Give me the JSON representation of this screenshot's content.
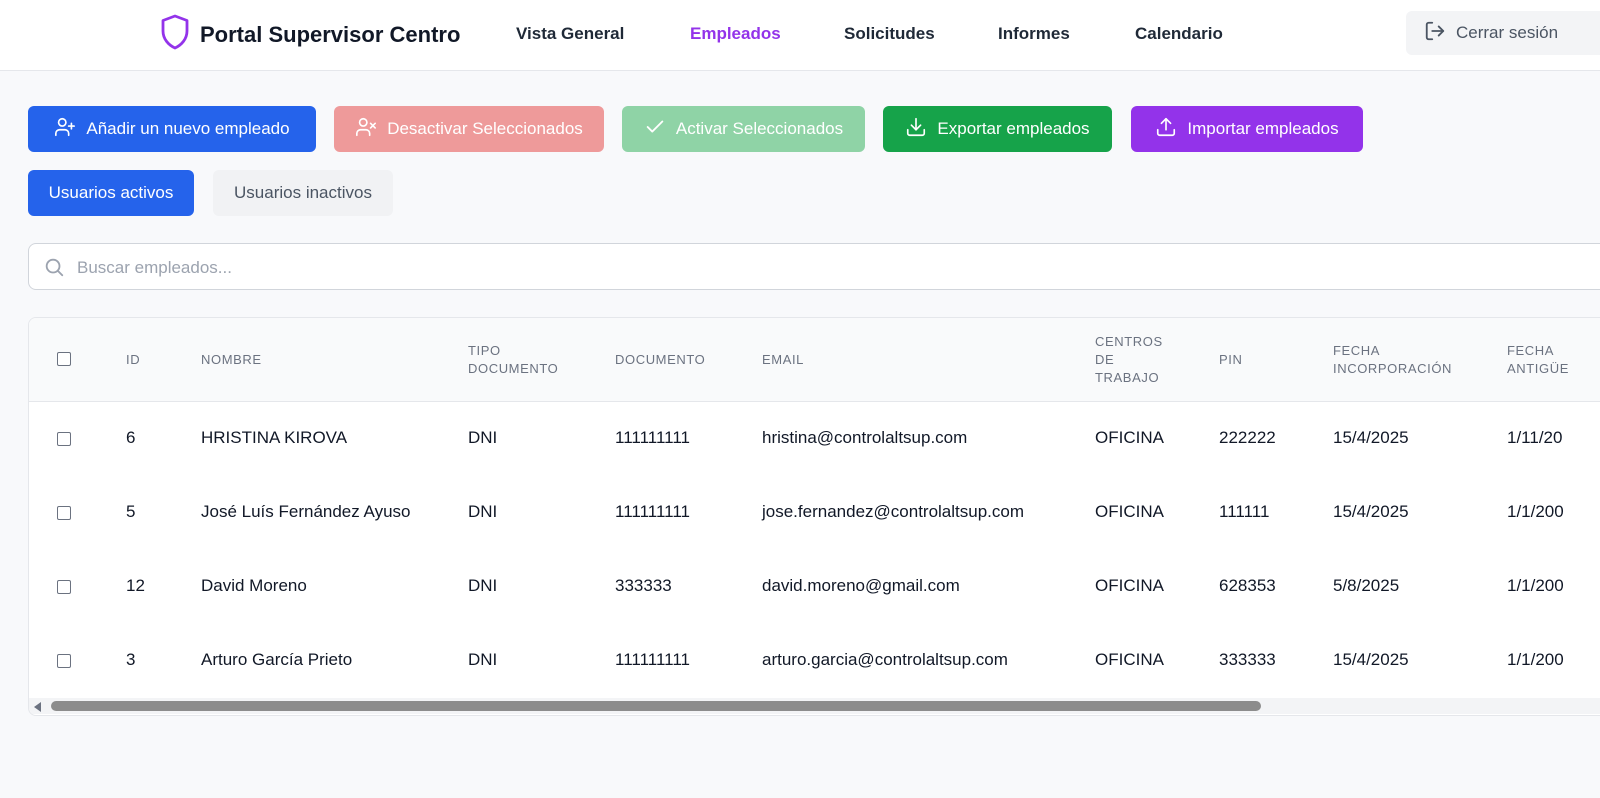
{
  "header": {
    "title": "Portal Supervisor Centro",
    "nav": [
      "Vista General",
      "Empleados",
      "Solicitudes",
      "Informes",
      "Calendario"
    ],
    "active_nav": "Empleados",
    "logout_label": "Cerrar sesión"
  },
  "toolbar": {
    "add_label": "Añadir un nuevo empleado",
    "deactivate_label": "Desactivar Seleccionados",
    "activate_label": "Activar Seleccionados",
    "export_label": "Exportar empleados",
    "import_label": "Importar empleados"
  },
  "tabs": {
    "active_label": "Usuarios activos",
    "inactive_label": "Usuarios inactivos"
  },
  "search": {
    "placeholder": "Buscar empleados..."
  },
  "table": {
    "columns": [
      "ID",
      "NOMBRE",
      "TIPO\nDOCUMENTO",
      "DOCUMENTO",
      "EMAIL",
      "CENTROS\nDE\nTRABAJO",
      "PIN",
      "FECHA\nINCORPORACIÓN",
      "FECHA\nANTIGÜE"
    ],
    "rows": [
      {
        "id": "6",
        "name": "HRISTINA KIROVA",
        "doc_type": "DNI",
        "doc": "111111111",
        "email": "hristina@controlaltsup.com",
        "center": "OFICINA",
        "pin": "222222",
        "joined": "15/4/2025",
        "seniority": "1/11/20"
      },
      {
        "id": "5",
        "name": "José Luís Fernández Ayuso",
        "doc_type": "DNI",
        "doc": "111111111",
        "email": "jose.fernandez@controlaltsup.com",
        "center": "OFICINA",
        "pin": "111111",
        "joined": "15/4/2025",
        "seniority": "1/1/200"
      },
      {
        "id": "12",
        "name": "David Moreno",
        "doc_type": "DNI",
        "doc": "333333",
        "email": "david.moreno@gmail.com",
        "center": "OFICINA",
        "pin": "628353",
        "joined": "5/8/2025",
        "seniority": "1/1/200"
      },
      {
        "id": "3",
        "name": "Arturo García Prieto",
        "doc_type": "DNI",
        "doc": "111111111",
        "email": "arturo.garcia@controlaltsup.com",
        "center": "OFICINA",
        "pin": "333333",
        "joined": "15/4/2025",
        "seniority": "1/1/200"
      }
    ]
  },
  "colors": {
    "primary": "#2563eb",
    "accent": "#9333ea",
    "danger_disabled": "#ee9a9a",
    "success_disabled": "#8fd3a6",
    "success": "#16a34a"
  },
  "icons": [
    "shield-icon",
    "logout-icon",
    "user-plus-icon",
    "user-x-icon",
    "check-icon",
    "download-icon",
    "upload-icon",
    "search-icon"
  ]
}
